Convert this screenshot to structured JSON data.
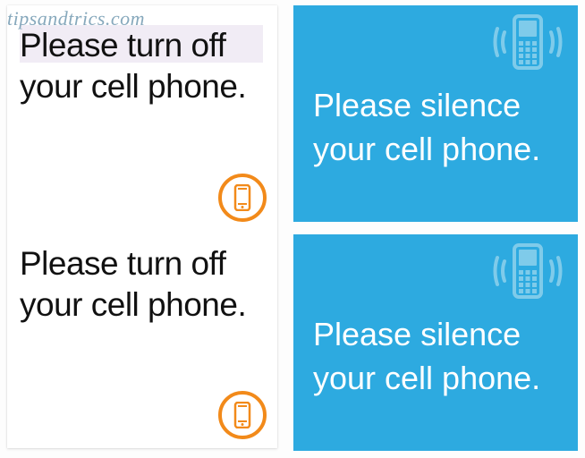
{
  "watermark": "tipsandtrics.com",
  "left": {
    "items": [
      {
        "text": "Please turn off your cell phone.",
        "icon": "cellphone-icon"
      },
      {
        "text": "Please turn off your cell phone.",
        "icon": "cellphone-icon"
      }
    ]
  },
  "right": {
    "items": [
      {
        "text": "Please silence your cell phone.",
        "icon": "phone-vibrate-icon"
      },
      {
        "text": "Please silence your cell phone.",
        "icon": "phone-vibrate-icon"
      }
    ]
  },
  "colors": {
    "accent_orange": "#f28a1a",
    "card_blue": "#2daae0",
    "icon_light_blue": "#7fcbea"
  }
}
